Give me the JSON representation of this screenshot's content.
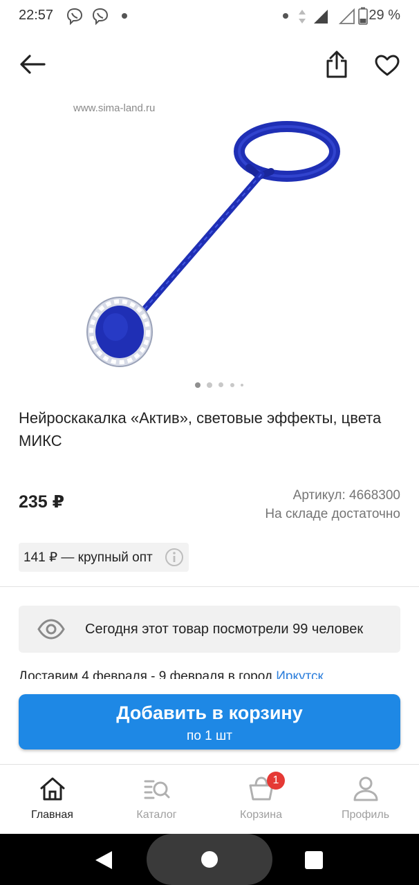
{
  "status_bar": {
    "time": "22:57",
    "battery_percent": "29 %",
    "icons": [
      "viber-icon",
      "viber-icon",
      "dot-icon",
      "dot-icon",
      "data-arrows-icon",
      "signal-icon",
      "signal-icon",
      "battery-icon"
    ]
  },
  "toolbar": {
    "back_icon": "arrow-left-icon",
    "share_icon": "share-icon",
    "favorite_icon": "heart-icon"
  },
  "product": {
    "watermark": "www.sima-land.ru",
    "image_pages": 5,
    "current_image": 1,
    "title": "Нейроскакалка «Актив», световые эффекты, цвета МИКС",
    "price": "235 ₽",
    "sku": "Артикул: 4668300",
    "stock": "На складе достаточно",
    "wholesale": "141 ₽ — крупный опт",
    "views_text": "Сегодня этот товар посмотрели 99 человек",
    "delivery_prefix": "Доставим 4 февраля - 9 февраля в город ",
    "delivery_city": "Иркутск"
  },
  "cart_button": {
    "label": "Добавить в корзину",
    "sub": "по 1 шт"
  },
  "bottom_nav": {
    "items": [
      {
        "label": "Главная",
        "icon": "home-icon",
        "active": true
      },
      {
        "label": "Каталог",
        "icon": "catalog-search-icon",
        "active": false
      },
      {
        "label": "Корзина",
        "icon": "basket-icon",
        "active": false
      },
      {
        "label": "Профиль",
        "icon": "profile-icon",
        "active": false
      }
    ],
    "cart_badge": "1"
  },
  "colors": {
    "accent": "#1e88e5",
    "product_blue": "#1f2fb5",
    "badge": "#e53935",
    "link": "#2a7ddb"
  }
}
